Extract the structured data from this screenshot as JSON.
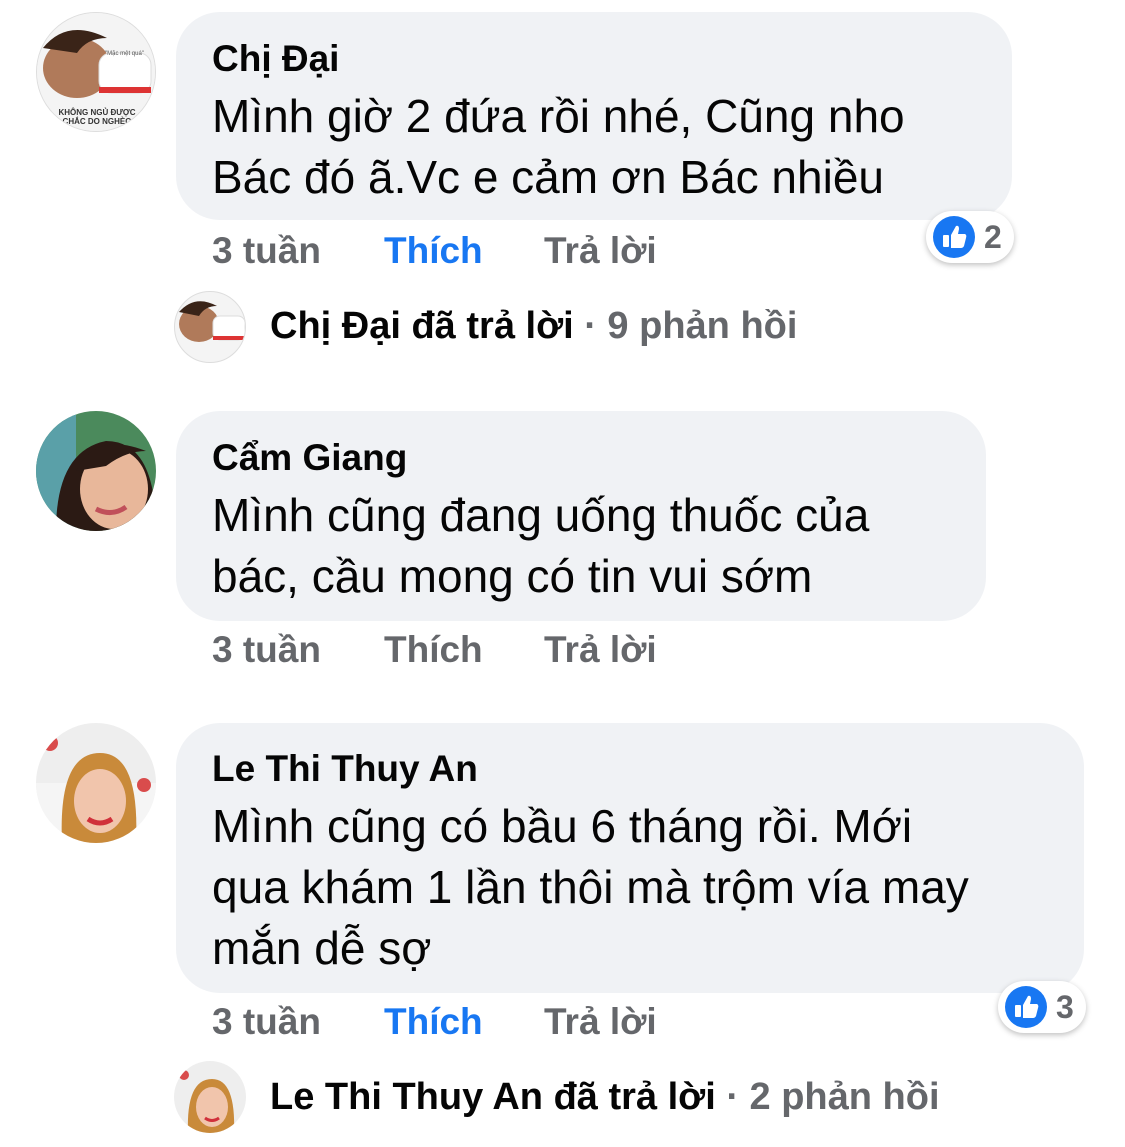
{
  "comments": [
    {
      "author": "Chị Đại",
      "text_lines": [
        "Mình giờ 2 đứa rồi nhé, Cũng nho",
        "Bác đó ã.Vc e cảm ơn Bác nhiều"
      ],
      "time": "3 tuần",
      "like_label": "Thích",
      "reply_label": "Trả lời",
      "liked": true,
      "reactions": {
        "icon": "like-icon",
        "count": "2"
      },
      "avatar_caption_lines": [
        "KHÔNG NGỦ ĐƯỢC",
        "CHẮC DO NGHÈO"
      ],
      "avatar_tag": "\"Mặc mệt quá\"",
      "reply_summary": {
        "author": "Chị Đại",
        "action": "đã trả lời",
        "separator": "·",
        "count": "9 phản hồi"
      }
    },
    {
      "author": "Cẩm Giang",
      "text_lines": [
        "Mình cũng đang uống thuốc của",
        "bác, cầu mong có tin vui sớm"
      ],
      "time": "3 tuần",
      "like_label": "Thích",
      "reply_label": "Trả lời",
      "liked": false
    },
    {
      "author": "Le Thi Thuy An",
      "text_lines": [
        "Mình cũng có bầu 6 tháng rồi. Mới",
        "qua khám 1 lần thôi mà trộm vía may",
        "mắn dễ sợ"
      ],
      "time": "3 tuần",
      "like_label": "Thích",
      "reply_label": "Trả lời",
      "liked": true,
      "reactions": {
        "icon": "like-icon",
        "count": "3"
      },
      "reply_summary": {
        "author": "Le Thi Thuy An",
        "action": "đã trả lời",
        "separator": "·",
        "count": "2 phản hồi"
      }
    }
  ],
  "colors": {
    "bubble": "#f0f2f5",
    "like_blue": "#1877f2",
    "meta_gray": "#65676b",
    "text": "#050505"
  }
}
